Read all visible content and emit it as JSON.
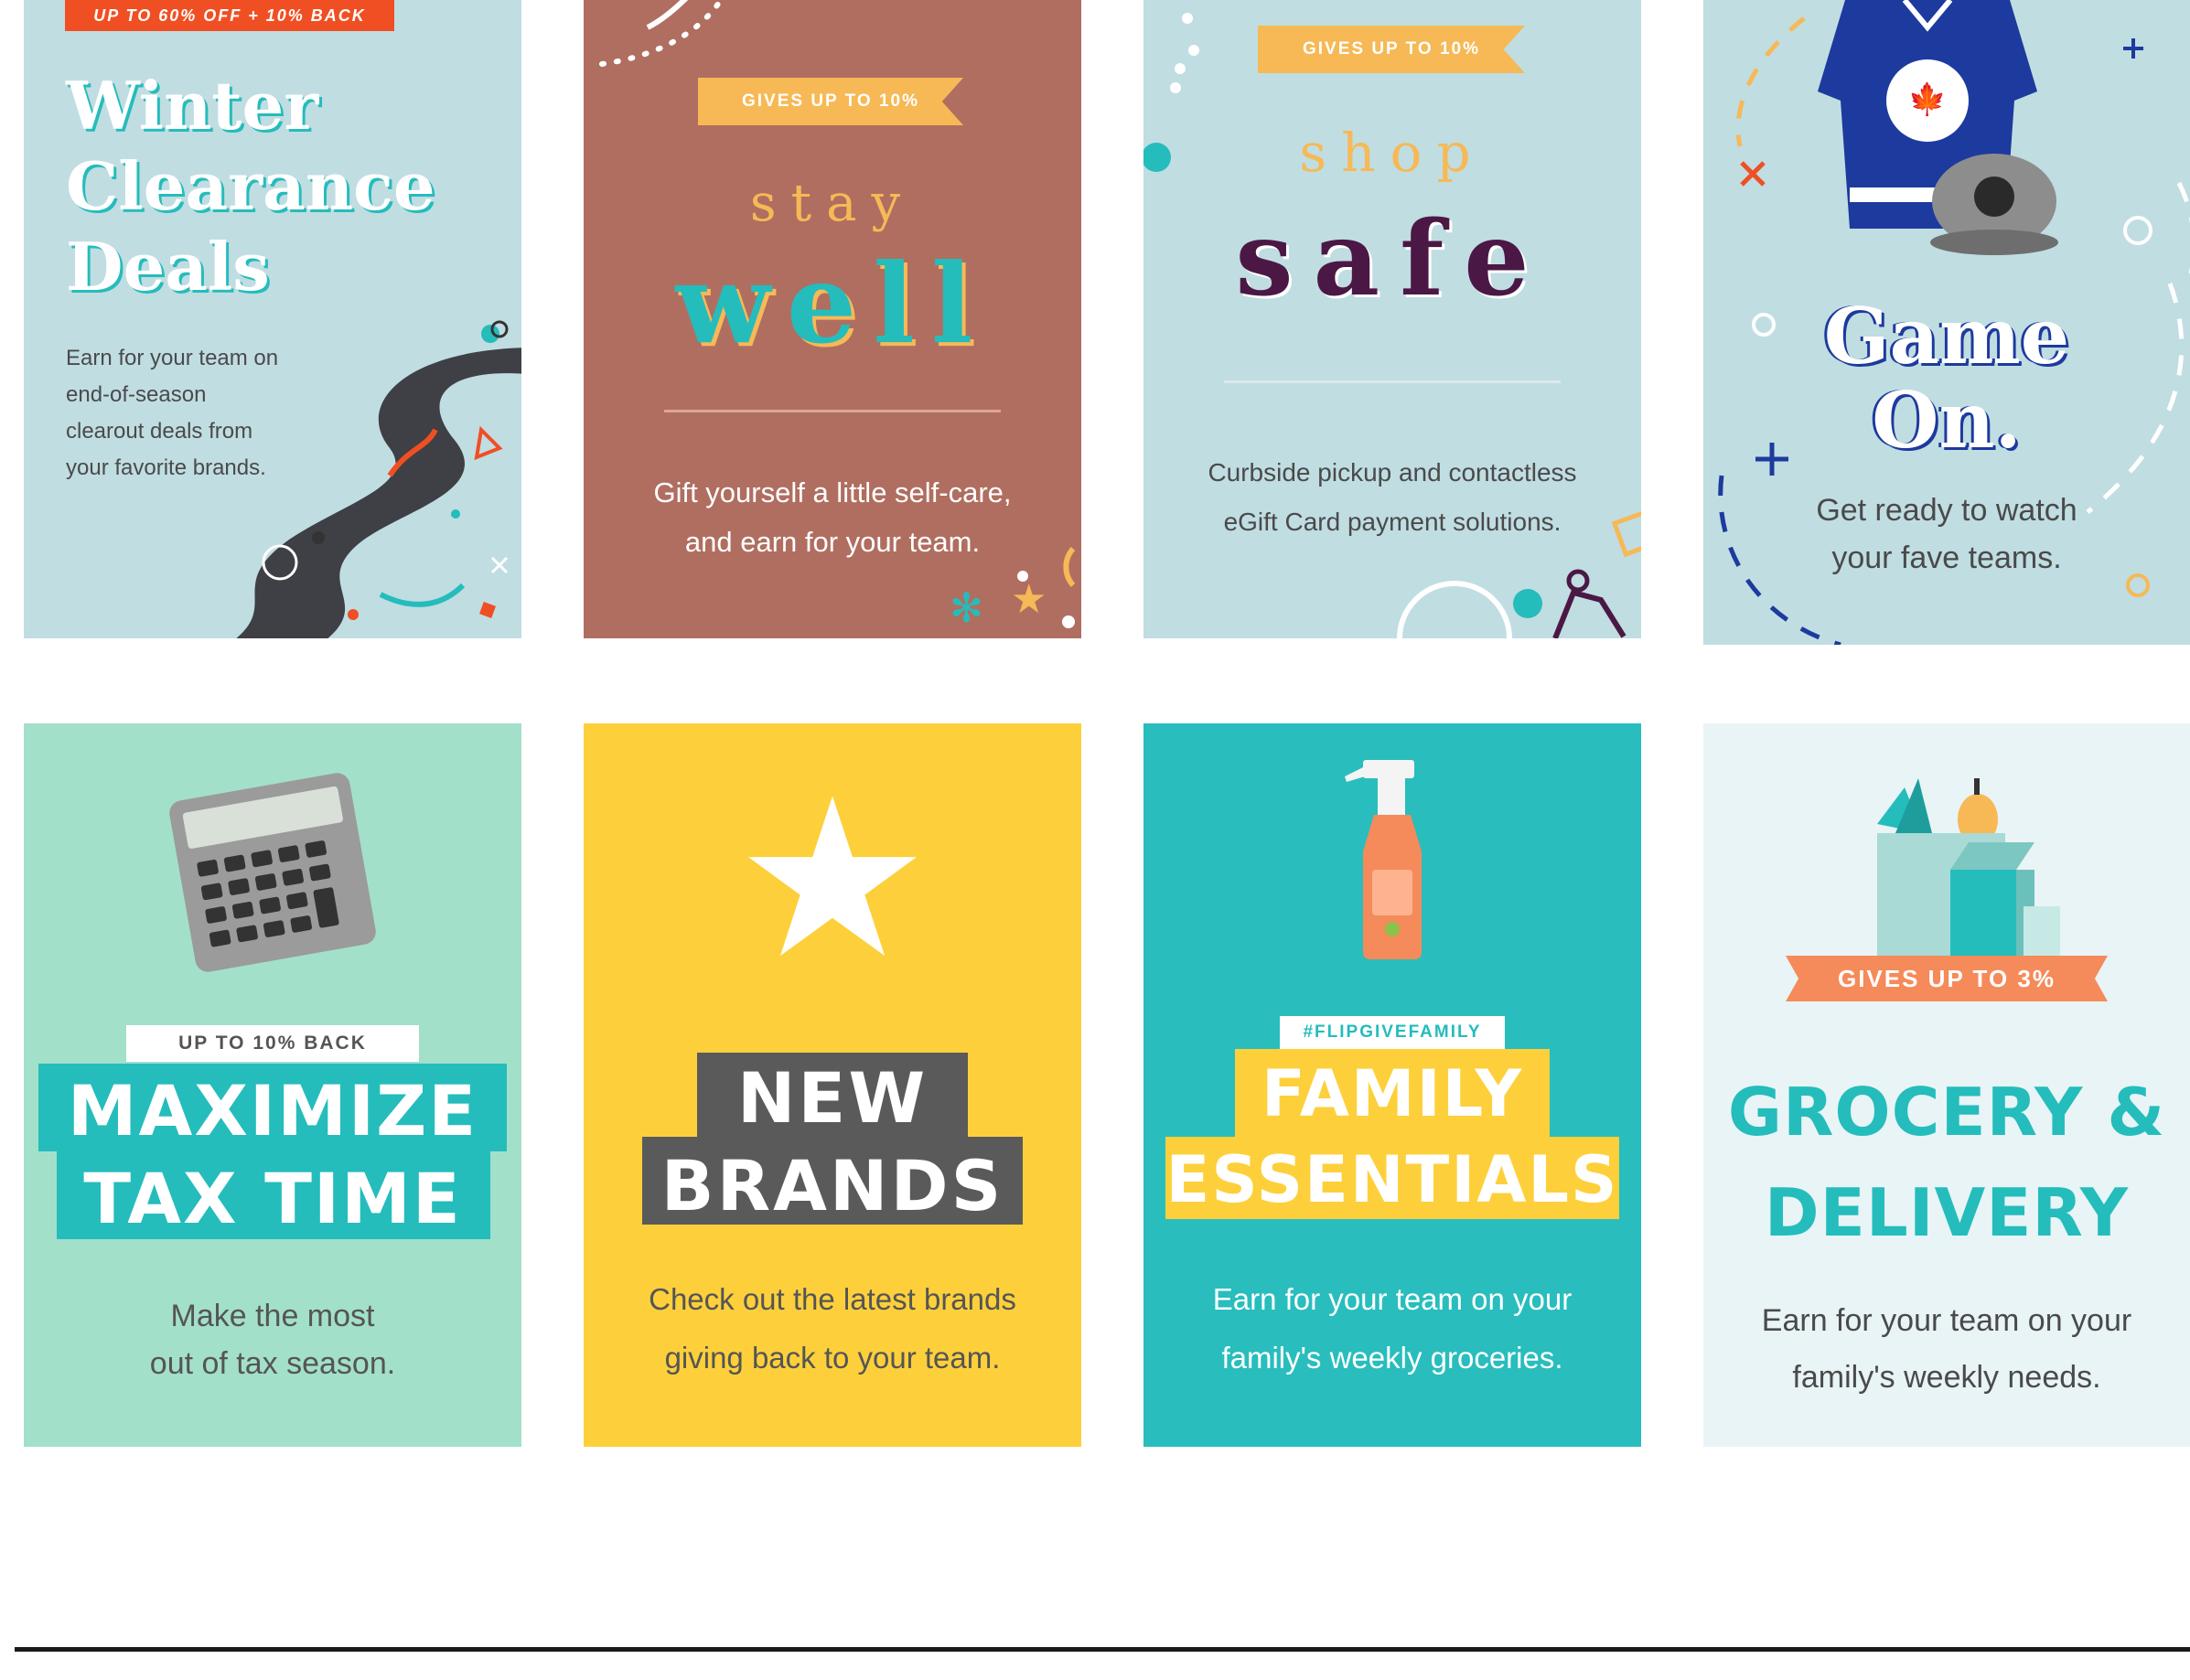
{
  "cards": [
    {
      "id": "winter-clearance",
      "badge": "UP TO 60% OFF + 10% BACK",
      "title_lines": [
        "Winter",
        "Clearance",
        "Deals"
      ],
      "desc_lines": [
        "Earn for your team on",
        "end-of-season",
        "clearout deals from",
        "your favorite brands."
      ],
      "bg": "#c0dde2"
    },
    {
      "id": "stay-well",
      "ribbon": "GIVES UP TO 10%",
      "kicker": "stay",
      "headline": "well",
      "desc_lines": [
        "Gift yourself a little self-care,",
        "and earn for your team."
      ],
      "bg": "#b06e60"
    },
    {
      "id": "shop-safe",
      "ribbon": "GIVES UP TO 10%",
      "kicker": "shop",
      "headline": "safe",
      "desc_lines": [
        "Curbside pickup and contactless",
        "eGift Card payment solutions."
      ],
      "bg": "#c0dde2"
    },
    {
      "id": "game-on",
      "title_lines": [
        "Game",
        "On."
      ],
      "desc_lines": [
        "Get ready to watch",
        "your fave teams."
      ],
      "bg": "#c0dde2"
    },
    {
      "id": "maximize-tax-time",
      "tag": "UP TO 10% BACK",
      "title_lines": [
        "MAXIMIZE",
        "TAX TIME"
      ],
      "desc_lines": [
        "Make the most",
        "out of tax season."
      ],
      "bg": "#a3e0ca"
    },
    {
      "id": "new-brands",
      "title_lines": [
        "NEW",
        "BRANDS"
      ],
      "desc_lines": [
        "Check out the latest brands",
        "giving back to your team."
      ],
      "bg": "#fdd03b"
    },
    {
      "id": "family-essentials",
      "tag": "#FLIPGIVEFAMILY",
      "title_lines": [
        "FAMILY",
        "ESSENTIALS"
      ],
      "desc_lines": [
        "Earn for your team on your",
        "family's weekly groceries."
      ],
      "bg": "#29bdbd"
    },
    {
      "id": "grocery-delivery",
      "ribbon": "GIVES UP TO 3%",
      "title_lines": [
        "GROCERY &",
        "DELIVERY"
      ],
      "desc_lines": [
        "Earn for your team on your",
        "family's weekly needs."
      ],
      "bg": "#e8f4f6"
    }
  ],
  "colors": {
    "teal": "#25bcbc",
    "orange_red": "#f04f23",
    "gold": "#f6b956",
    "plum": "#4b1845",
    "navy": "#1d3a9e",
    "dark_gray": "#5a5a5a",
    "salmon": "#f58a5a"
  },
  "icons": [
    "calculator-icon",
    "star-icon",
    "spray-bottle-icon",
    "grocery-bag-icon",
    "hockey-jersey-icon",
    "baseball-cap-icon",
    "road-icon"
  ]
}
